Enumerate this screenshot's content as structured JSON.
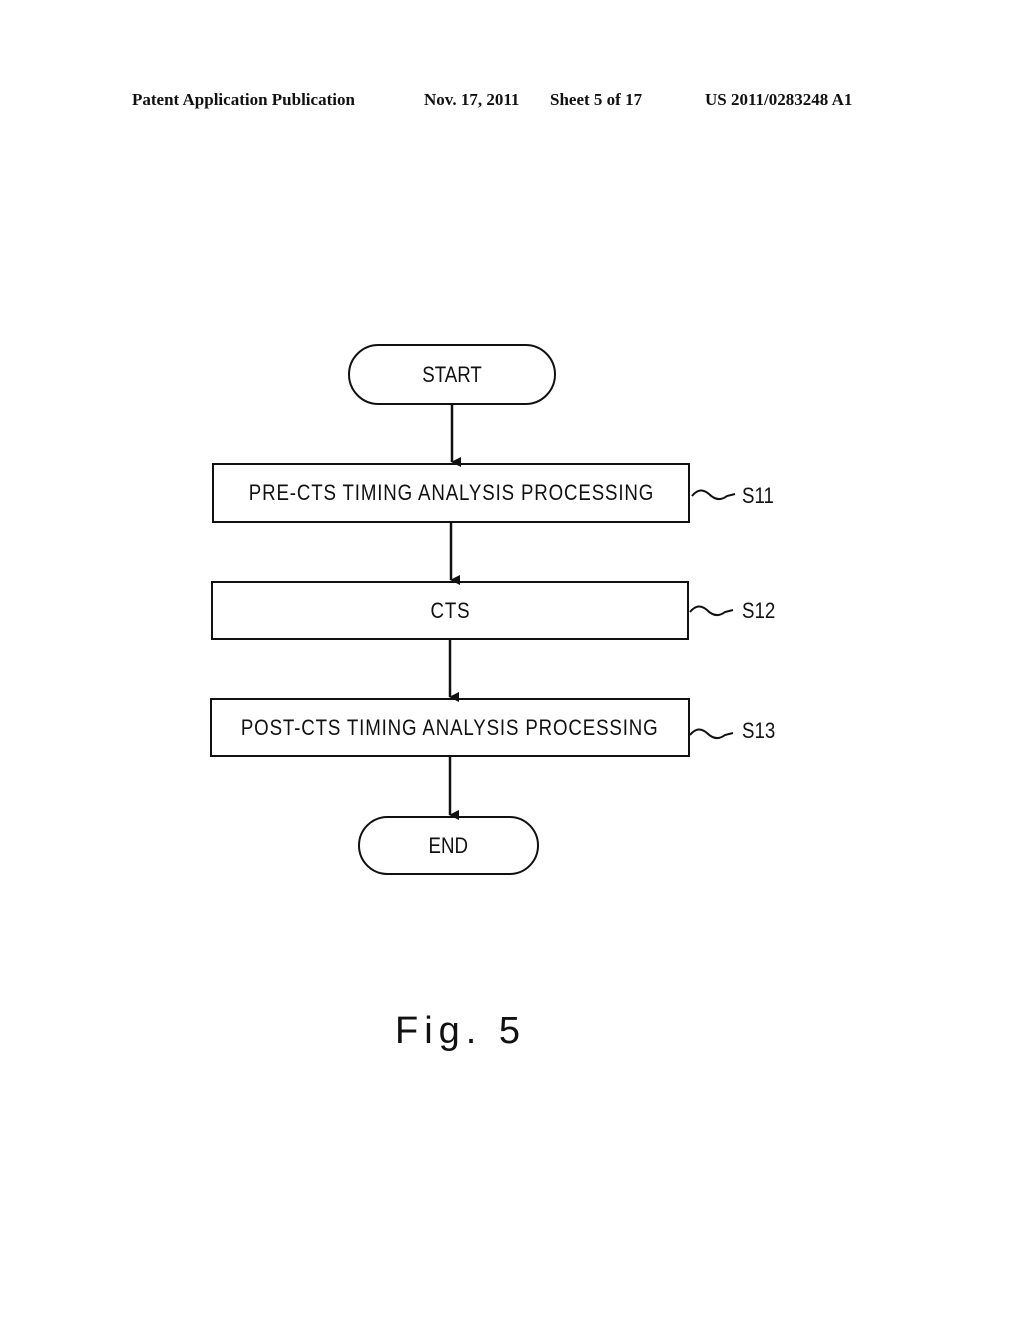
{
  "header": {
    "publication": "Patent Application Publication",
    "date": "Nov. 17, 2011",
    "sheet": "Sheet 5 of 17",
    "number": "US 2011/0283248 A1"
  },
  "flowchart": {
    "start": "START",
    "steps": [
      {
        "label": "PRE-CTS TIMING ANALYSIS PROCESSING",
        "id": "S11"
      },
      {
        "label": "CTS",
        "id": "S12"
      },
      {
        "label": "POST-CTS TIMING ANALYSIS PROCESSING",
        "id": "S13"
      }
    ],
    "end": "END"
  },
  "figure_label": "Fig. 5"
}
